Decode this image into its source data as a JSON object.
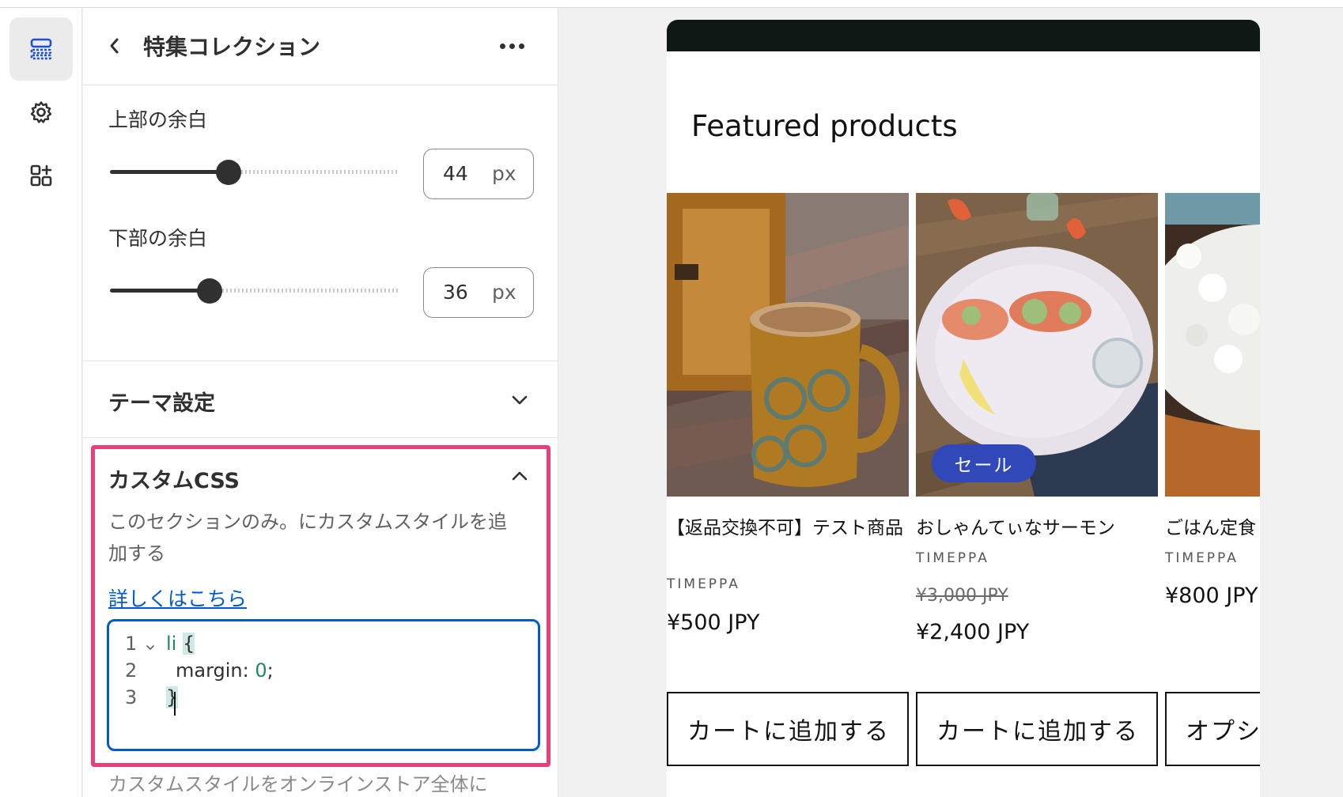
{
  "panel": {
    "title": "特集コレクション",
    "padding_top": {
      "label": "上部の余白",
      "value": "44",
      "unit": "px",
      "fraction": 0.44
    },
    "padding_bottom": {
      "label": "下部の余白",
      "value": "36",
      "unit": "px",
      "fraction": 0.37
    },
    "theme_settings_label": "テーマ設定",
    "custom_css": {
      "heading": "カスタムCSS",
      "description": "このセクションのみ。にカスタムスタイルを追加する",
      "link": "詳しくはこちら",
      "code_lines": [
        {
          "number": "1",
          "selector": "li",
          "brace": "{"
        },
        {
          "number": "2",
          "property": "margin: ",
          "value": "0",
          "end": ";"
        },
        {
          "number": "3",
          "brace": "}"
        }
      ],
      "footer": "カスタムスタイルをオンラインストア全体に"
    }
  },
  "preview": {
    "section_title": "Featured products",
    "products": [
      {
        "name": "【返品交換不可】テスト商品",
        "vendor": "TIMEPPA",
        "price": "¥500 JPY",
        "button": "カートに追加する"
      },
      {
        "name": "おしゃんてぃなサーモン",
        "vendor": "TIMEPPA",
        "compare_price": "¥3,000 JPY",
        "price": "¥2,400 JPY",
        "badge": "セール",
        "button": "カートに追加する"
      },
      {
        "name": "ごはん定食",
        "vendor": "TIMEPPA",
        "price": "¥800 JPY",
        "button": "オプションを選択"
      }
    ]
  },
  "colors": {
    "accent_link": "#005bd3",
    "highlight_outline": "#ec3d74",
    "sale_badge": "#3148b9",
    "preview_header": "#0f1814"
  },
  "icons": [
    "sections-icon",
    "gear-icon",
    "apps-add-icon",
    "back-chevron-icon",
    "more-dots-icon",
    "chevron-down-icon",
    "chevron-up-icon",
    "fold-chevron-icon"
  ]
}
